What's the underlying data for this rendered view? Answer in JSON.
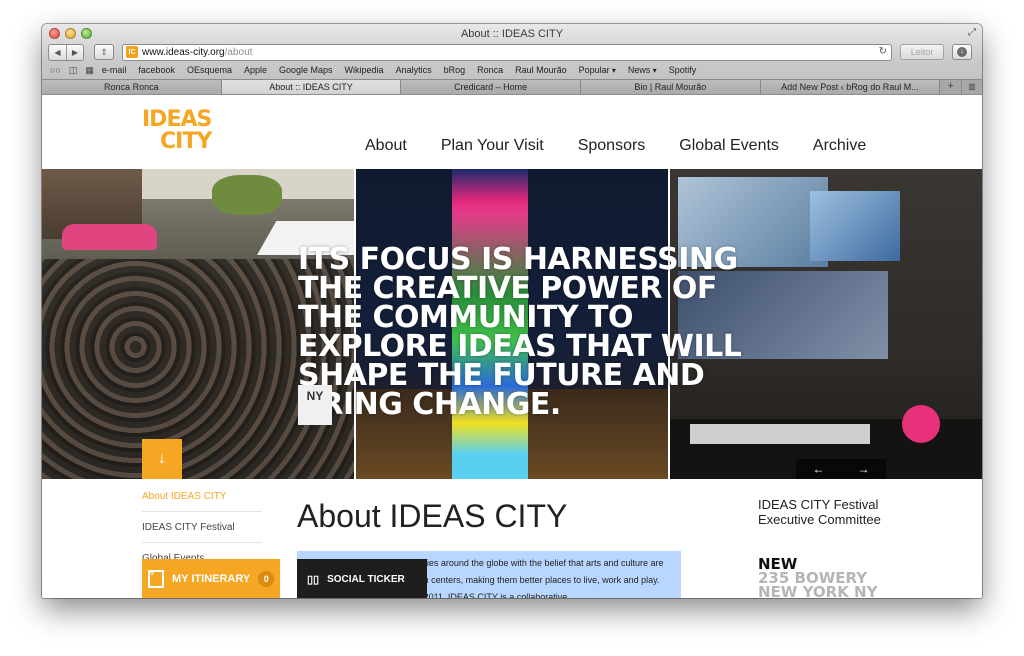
{
  "window": {
    "title": "About :: IDEAS CITY",
    "url_host": "www.ideas-city.org",
    "url_path": "/about",
    "favicon": "IC",
    "reader_label": "Leitor"
  },
  "bookmarks": [
    {
      "label": "e-mail"
    },
    {
      "label": "facebook"
    },
    {
      "label": "OEsquema"
    },
    {
      "label": "Apple"
    },
    {
      "label": "Google Maps"
    },
    {
      "label": "Wikipedia"
    },
    {
      "label": "Analytics"
    },
    {
      "label": "bRog"
    },
    {
      "label": "Ronca"
    },
    {
      "label": "Raul Mourão"
    },
    {
      "label": "Popular",
      "dropdown": true
    },
    {
      "label": "News",
      "dropdown": true
    },
    {
      "label": "Spotify"
    }
  ],
  "tabs": [
    {
      "label": "Ronca Ronca",
      "active": false
    },
    {
      "label": "About :: IDEAS CITY",
      "active": true
    },
    {
      "label": "Credicard – Home",
      "active": false
    },
    {
      "label": "Bio | Raul Mourão",
      "active": false
    },
    {
      "label": "Add New Post ‹ bRog do Raul M...",
      "active": false
    }
  ],
  "site": {
    "logo_line1": "IDEAS",
    "logo_line2": "CITY",
    "nav": [
      "About",
      "Plan Your Visit",
      "Sponsors",
      "Global Events",
      "Archive"
    ],
    "hero_text": "Its focus is harnessing the creative power of the community to explore ideas that will shape the future and bring change.",
    "hero_badge": "NY",
    "down_arrow": "↓",
    "prev_arrow": "←",
    "next_arrow": "→",
    "sidenav": [
      "About IDEAS CITY",
      "IDEAS CITY Festival",
      "Global Events"
    ],
    "content_title": "About IDEAS CITY",
    "content_para": "IDEAS CITY is a network of cities around the globe with the belief that arts and culture are essential to the vitality of urban centers, making them better places to live, work and play. Launched in New Museum in 2011, IDEAS CITY is a collaborative",
    "right_heading": "IDEAS CITY Festival Executive Committee",
    "new_line1": "NEW",
    "new_line2": "235 BOWERY",
    "new_line3": "NEW YORK NY",
    "itinerary_label": "MY ITINERARY",
    "itinerary_count": "0",
    "ticker_label": "SOCIAL TICKER"
  },
  "colors": {
    "brand_orange": "#f5a623",
    "selection_blue": "#b8d6ff",
    "ticker_black": "#1e1e1e"
  }
}
